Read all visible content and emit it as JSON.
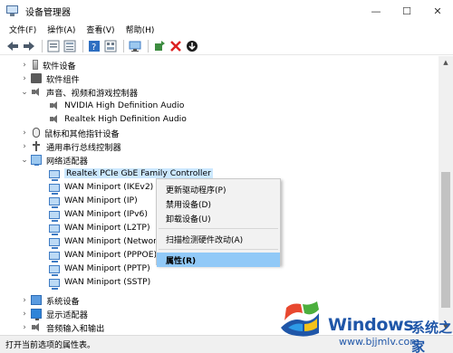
{
  "window": {
    "title": "设备管理器",
    "controls": {
      "minimize": "—",
      "maximize": "☐",
      "close": "✕"
    }
  },
  "menubar": {
    "items": [
      {
        "label": "文件(F)"
      },
      {
        "label": "操作(A)"
      },
      {
        "label": "查看(V)"
      },
      {
        "label": "帮助(H)"
      }
    ]
  },
  "toolbar": {
    "icons": [
      "back-arrow-icon",
      "forward-arrow-icon",
      "properties-icon",
      "list-icon",
      "help-icon",
      "view-icon",
      "computer-icon",
      "add-driver-icon",
      "uninstall-icon",
      "update-icon"
    ]
  },
  "tree": {
    "rows": [
      {
        "label": "软件设备",
        "expander": "›",
        "icon": "disk-icon",
        "depth": 1
      },
      {
        "label": "软件组件",
        "expander": "›",
        "icon": "chip-icon",
        "depth": 1
      },
      {
        "label": "声音、视频和游戏控制器",
        "expander": "⌄",
        "icon": "sound-icon",
        "depth": 1
      },
      {
        "label": "NVIDIA High Definition Audio",
        "expander": "",
        "icon": "sound-icon",
        "depth": 2
      },
      {
        "label": "Realtek High Definition Audio",
        "expander": "",
        "icon": "sound-icon",
        "depth": 2
      },
      {
        "label": "鼠标和其他指针设备",
        "expander": "›",
        "icon": "mouse-icon",
        "depth": 1
      },
      {
        "label": "通用串行总线控制器",
        "expander": "›",
        "icon": "usb-icon",
        "depth": 1
      },
      {
        "label": "网络适配器",
        "expander": "⌄",
        "icon": "network-icon",
        "depth": 1
      },
      {
        "label": "Realtek PCIe GbE Family Controller",
        "expander": "",
        "icon": "nic-icon",
        "depth": 2,
        "selected": true
      },
      {
        "label": "WAN Miniport (IKEv2)",
        "expander": "",
        "icon": "nic-icon",
        "depth": 2
      },
      {
        "label": "WAN Miniport (IP)",
        "expander": "",
        "icon": "nic-icon",
        "depth": 2
      },
      {
        "label": "WAN Miniport (IPv6)",
        "expander": "",
        "icon": "nic-icon",
        "depth": 2
      },
      {
        "label": "WAN Miniport (L2TP)",
        "expander": "",
        "icon": "nic-icon",
        "depth": 2
      },
      {
        "label": "WAN Miniport (Network Monitor)",
        "expander": "",
        "icon": "nic-icon",
        "depth": 2
      },
      {
        "label": "WAN Miniport (PPPOE)",
        "expander": "",
        "icon": "nic-icon",
        "depth": 2
      },
      {
        "label": "WAN Miniport (PPTP)",
        "expander": "",
        "icon": "nic-icon",
        "depth": 2
      },
      {
        "label": "WAN Miniport (SSTP)",
        "expander": "",
        "icon": "nic-icon",
        "depth": 2
      },
      {
        "label": "系统设备",
        "expander": "›",
        "icon": "system-icon",
        "depth": 1
      },
      {
        "label": "显示适配器",
        "expander": "›",
        "icon": "display-icon",
        "depth": 1
      },
      {
        "label": "音频输入和输出",
        "expander": "›",
        "icon": "sound-icon",
        "depth": 1
      }
    ]
  },
  "context_menu": {
    "items": [
      {
        "label": "更新驱动程序(P)"
      },
      {
        "label": "禁用设备(D)"
      },
      {
        "label": "卸载设备(U)"
      },
      {
        "label": "扫描检测硬件改动(A)"
      },
      {
        "label": "属性(R)",
        "highlighted": true
      }
    ]
  },
  "statusbar": {
    "text": "打开当前选项的属性表。"
  },
  "watermark": {
    "brand": "Windows",
    "cn": "系统之家",
    "url": "www.bjjmlv.com"
  },
  "colors": {
    "selection": "#cce8ff",
    "menu_highlight": "#91c9f7",
    "watermark_blue": "#1f56a8"
  }
}
